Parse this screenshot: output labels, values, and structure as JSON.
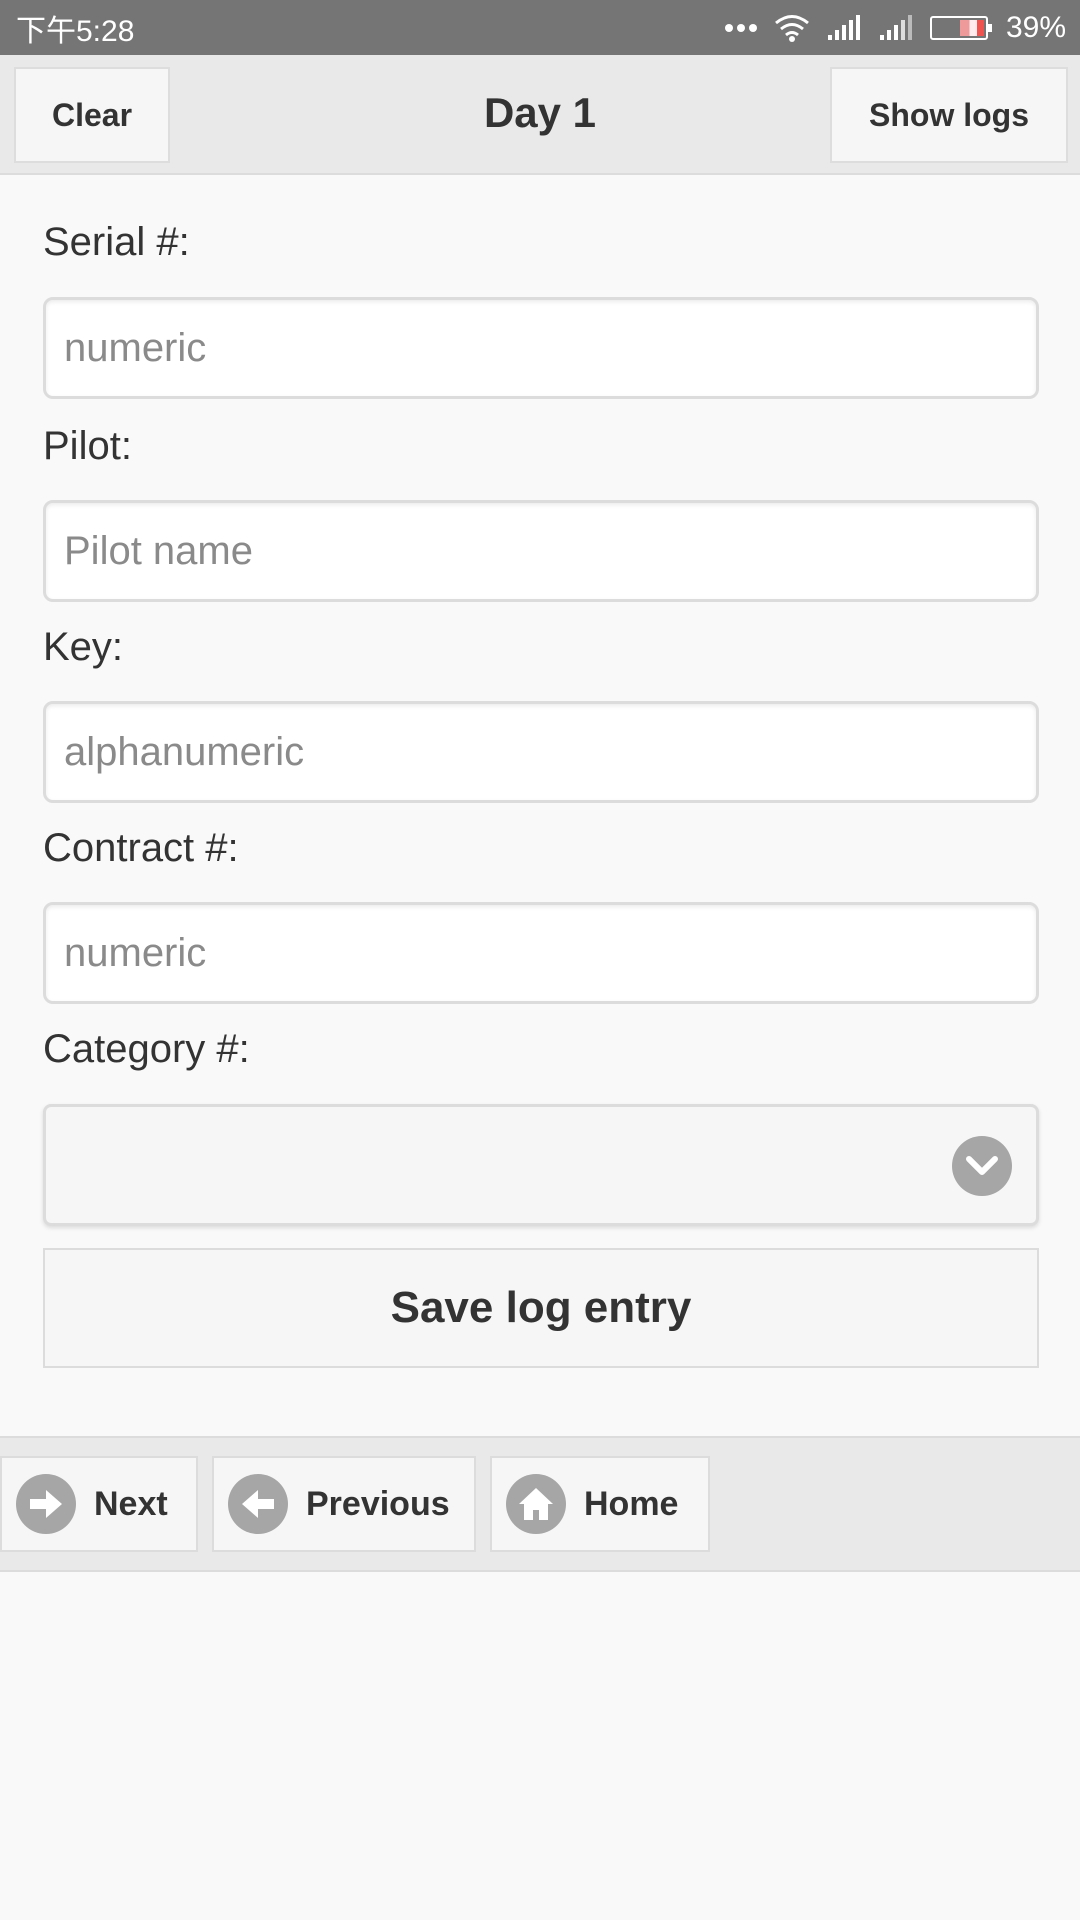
{
  "status_bar": {
    "time": "下午5:28",
    "battery_percent": "39%",
    "icons": [
      "more-dots-icon",
      "wifi-icon",
      "signal-icon",
      "signal-icon",
      "battery-icon"
    ]
  },
  "header": {
    "clear_label": "Clear",
    "title": "Day 1",
    "show_logs_label": "Show logs"
  },
  "form": {
    "serial": {
      "label": "Serial #:",
      "placeholder": "numeric",
      "value": ""
    },
    "pilot": {
      "label": "Pilot:",
      "placeholder": "Pilot name",
      "value": ""
    },
    "key": {
      "label": "Key:",
      "placeholder": "alphanumeric",
      "value": ""
    },
    "contract": {
      "label": "Contract #:",
      "placeholder": "numeric",
      "value": ""
    },
    "category": {
      "label": "Category #:",
      "value": "",
      "icon": "chevron-down-icon"
    },
    "save_label": "Save log entry"
  },
  "footer": {
    "next_label": "Next",
    "previous_label": "Previous",
    "home_label": "Home",
    "icons": [
      "arrow-right-icon",
      "arrow-left-icon",
      "home-icon"
    ]
  },
  "colors": {
    "status_bar": "#757575",
    "header_bg": "#e9e9e9",
    "page_bg": "#f9f9f9",
    "icon_circle": "#a6a6a6",
    "text": "#333333"
  }
}
